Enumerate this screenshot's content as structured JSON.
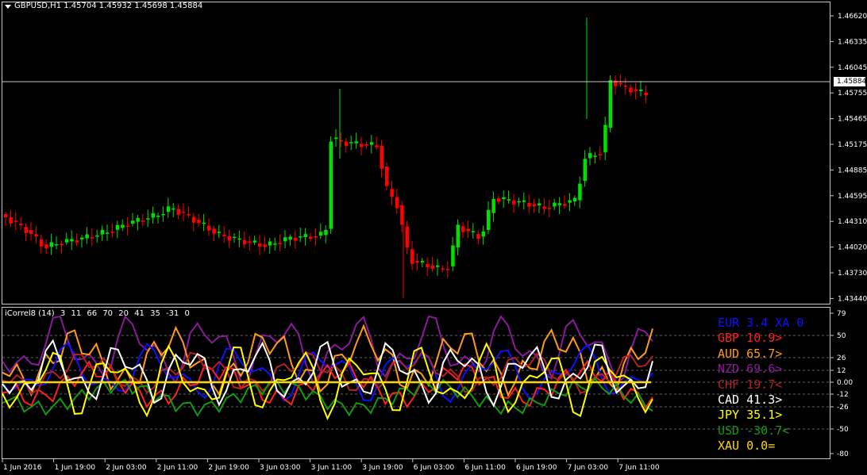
{
  "main_chart": {
    "symbol": "GBPUSD,H1",
    "ohlc": "1.45704 1.45932 1.45698 1.45884",
    "current_price": "1.45884",
    "price_axis": [
      "1.46620",
      "1.46335",
      "1.46045",
      "1.45755",
      "1.45465",
      "1.45175",
      "1.44885",
      "1.44595",
      "1.44310",
      "1.44020",
      "1.43730",
      "1.43440"
    ],
    "up_color": "#00e000",
    "down_color": "#ff0000"
  },
  "indicator": {
    "name": "iCorrel8 (14)",
    "params": [
      "3",
      "11",
      "66",
      "70",
      "20",
      "41",
      "35",
      "-31",
      "0"
    ],
    "axis_labels": [
      "79",
      "50",
      "26",
      "12",
      "0.00",
      "-12",
      "-26",
      "-50",
      "-80"
    ],
    "currencies": [
      {
        "text": "EUR 3.4 XA 0",
        "color": "#1010ff"
      },
      {
        "text": "GBP 10.9>",
        "color": "#ff2020"
      },
      {
        "text": "AUD 65.7>",
        "color": "#ff9a1a"
      },
      {
        "text": "NZD 69.6>",
        "color": "#8b1a9b"
      },
      {
        "text": "CHF 19.7<",
        "color": "#b22222"
      },
      {
        "text": "CAD 41.3>",
        "color": "#ffffff"
      },
      {
        "text": "JPY 35.1>",
        "color": "#ffff00"
      },
      {
        "text": "USD -30.7<",
        "color": "#129a12"
      },
      {
        "text": "XAU 0.0=",
        "color": "#ffd700"
      }
    ]
  },
  "time_axis": [
    "1 Jun 2016",
    "1 Jun 19:00",
    "2 Jun 03:00",
    "2 Jun 11:00",
    "2 Jun 19:00",
    "3 Jun 03:00",
    "3 Jun 11:00",
    "3 Jun 19:00",
    "6 Jun 03:00",
    "6 Jun 11:00",
    "6 Jun 19:00",
    "7 Jun 03:00",
    "7 Jun 11:00"
  ]
}
